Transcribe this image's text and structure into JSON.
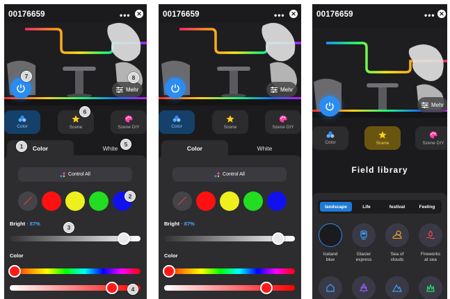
{
  "screens": [
    {
      "device_id": "00176659",
      "mehr_label": "Mehr",
      "modes": [
        "Color",
        "Scene",
        "Szene DIY"
      ],
      "tabs": [
        "Color",
        "White"
      ],
      "control_all": "Control All",
      "swatches": [
        "none",
        "#ff1111",
        "#eef01e",
        "#22dd22",
        "#1111ee"
      ],
      "bright_label": "Bright",
      "bright_value": "87%",
      "bright_level": 0.87,
      "color_label": "Color",
      "hue_level": 0.02,
      "saturation_level": 0.78,
      "badges": [
        "1",
        "2",
        "3",
        "4",
        "5",
        "6",
        "7",
        "8"
      ]
    },
    {
      "device_id": "00176659",
      "mehr_label": "Mehr",
      "modes": [
        "Color",
        "Scene",
        "Szene DIY"
      ],
      "tabs": [
        "Color",
        "White"
      ],
      "control_all": "Control All",
      "bright_label": "Bright",
      "bright_value": "87%",
      "bright_level": 0.87,
      "color_label": "Color",
      "hue_level": 0.02,
      "saturation_level": 0.78
    },
    {
      "device_id": "00176659",
      "mehr_label": "Mehr",
      "modes": [
        "Color",
        "Scene",
        "Szene DIY"
      ],
      "library_title": "Field library",
      "categories": [
        "landscape",
        "Life",
        "festival",
        "Feeling"
      ],
      "scenes": [
        {
          "name_line1": "Iceland",
          "name_line2": "blue",
          "icon": "ring-icon"
        },
        {
          "name_line1": "Glacier",
          "name_line2": "express",
          "icon": "train-icon"
        },
        {
          "name_line1": "Sea of",
          "name_line2": "clouds",
          "icon": "cloud-moon-icon"
        },
        {
          "name_line1": "Fireworks",
          "name_line2": "at sea",
          "icon": "fireworks-icon"
        }
      ],
      "second_row_icons": [
        "house-icon",
        "tree-icon",
        "mountain-icon",
        "grass-icon"
      ]
    }
  ],
  "colors": {
    "accent_blue": "#2b8cf2",
    "accent_gold": "#ffd64a",
    "panel_bg": "#1b1b1d",
    "card_bg": "#2d2d30"
  }
}
